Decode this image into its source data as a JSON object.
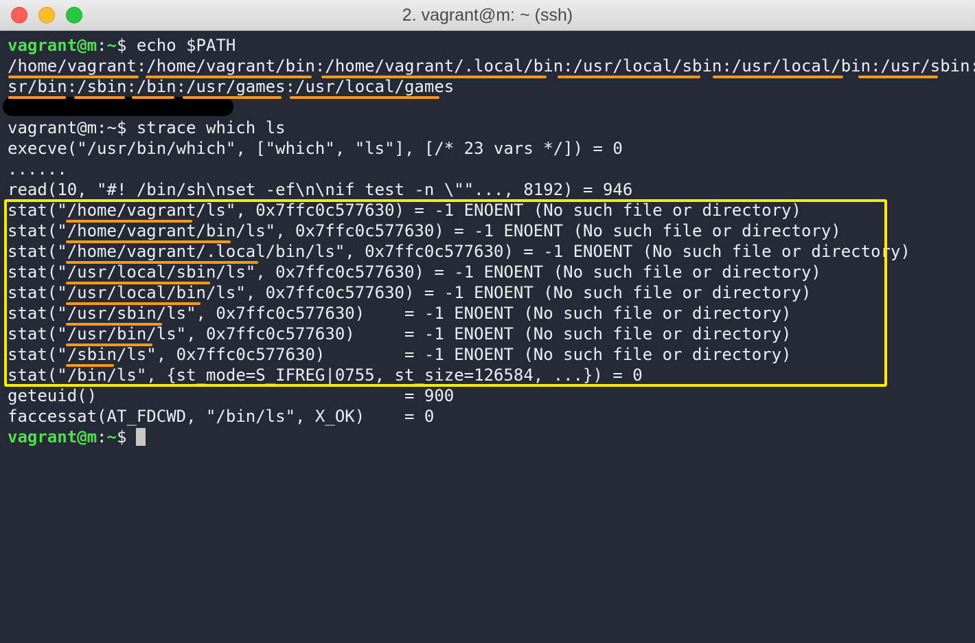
{
  "window": {
    "title": "2. vagrant@m: ~ (ssh)"
  },
  "prompt": {
    "user_host": "vagrant@m",
    "sep": ":",
    "path": "~",
    "symbol": "$"
  },
  "commands": {
    "echo": " echo $PATH",
    "strace": " strace which ls"
  },
  "output": {
    "path_line1": "/home/vagrant:/home/vagrant/bin:/home/vagrant/.local/bin:/usr/local/sbin:/usr/local/bin:/usr/sbin:/u",
    "path_line2": "sr/bin:/sbin:/bin:/usr/games:/usr/local/games",
    "strace_lines": [
      "execve(\"/usr/bin/which\", [\"which\", \"ls\"], [/* 23 vars */]) = 0",
      "......",
      "read(10, \"#! /bin/sh\\nset -ef\\n\\nif test -n \\\"\"..., 8192) = 946",
      "stat(\"/home/vagrant/ls\", 0x7ffc0c577630) = -1 ENOENT (No such file or directory)",
      "stat(\"/home/vagrant/bin/ls\", 0x7ffc0c577630) = -1 ENOENT (No such file or directory)",
      "stat(\"/home/vagrant/.local/bin/ls\", 0x7ffc0c577630) = -1 ENOENT (No such file or directory)",
      "stat(\"/usr/local/sbin/ls\", 0x7ffc0c577630) = -1 ENOENT (No such file or directory)",
      "stat(\"/usr/local/bin/ls\", 0x7ffc0c577630) = -1 ENOENT (No such file or directory)",
      "stat(\"/usr/sbin/ls\", 0x7ffc0c577630)    = -1 ENOENT (No such file or directory)",
      "stat(\"/usr/bin/ls\", 0x7ffc0c577630)     = -1 ENOENT (No such file or directory)",
      "stat(\"/sbin/ls\", 0x7ffc0c577630)        = -1 ENOENT (No such file or directory)",
      "stat(\"/bin/ls\", {st_mode=S_IFREG|0755, st_size=126584, ...}) = 0",
      "geteuid()                               = 900",
      "faccessat(AT_FDCWD, \"/bin/ls\", X_OK)    = 0"
    ]
  },
  "colors": {
    "background": "#262a36",
    "prompt_green": "#4ee04e",
    "highlight_box": "#ffea00",
    "underline": "#f79a1a",
    "redaction": "#000000"
  }
}
